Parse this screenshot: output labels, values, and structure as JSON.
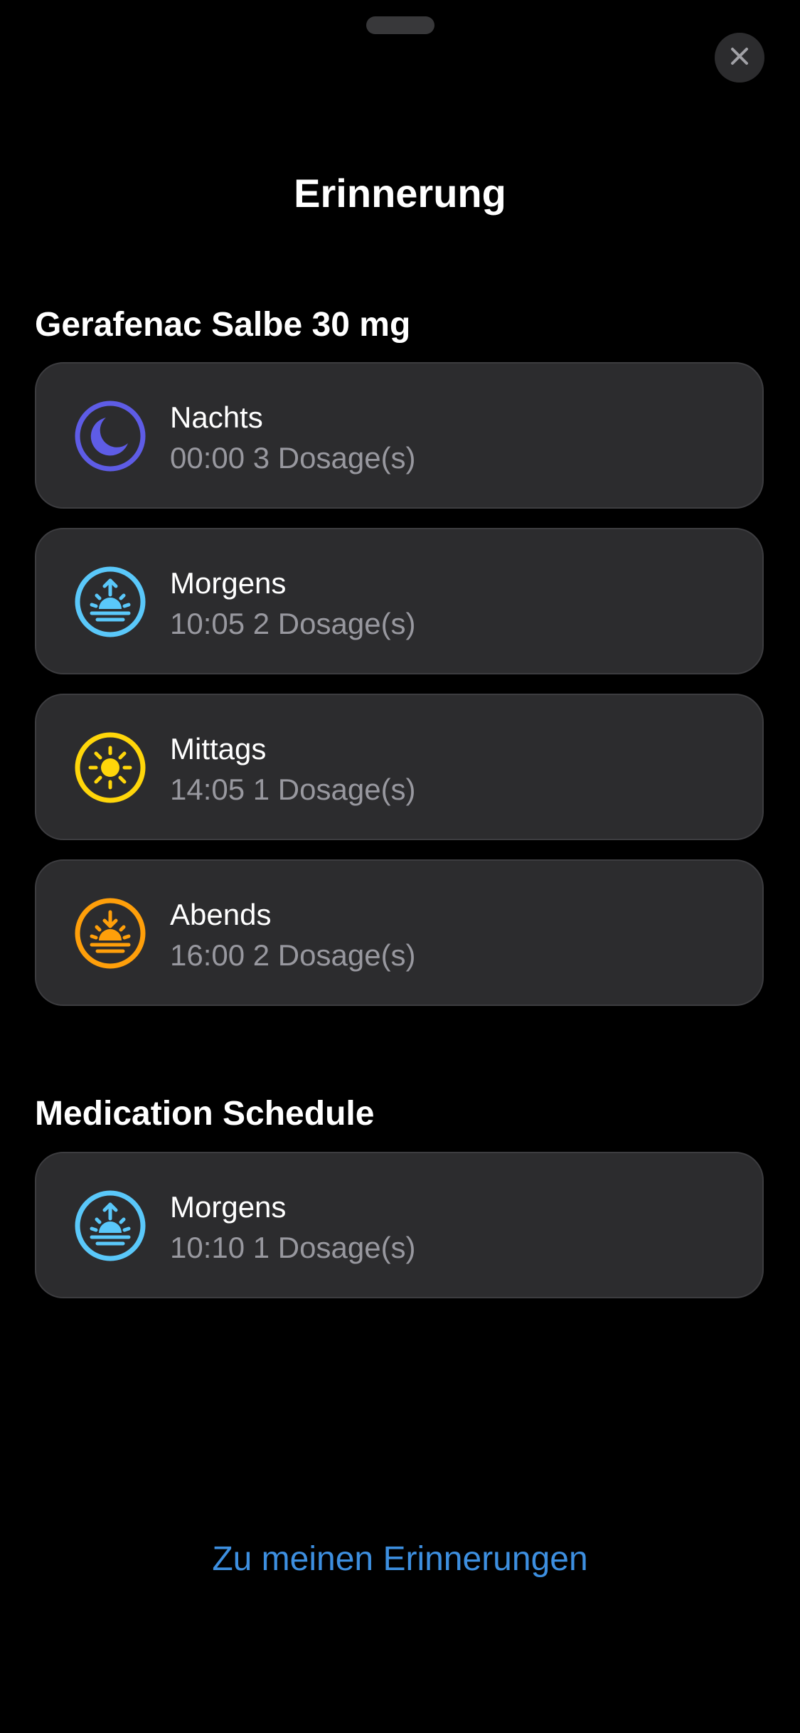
{
  "header": {
    "title": "Erinnerung",
    "close_icon": "xmark-icon"
  },
  "sections": [
    {
      "title": "Gerafenac Salbe 30 mg",
      "items": [
        {
          "label": "Nachts",
          "detail": "00:00 3 Dosage(s)",
          "icon": "moon-icon",
          "color": "#5e5ce6"
        },
        {
          "label": "Morgens",
          "detail": "10:05 2 Dosage(s)",
          "icon": "sunrise-icon",
          "color": "#5ac8fa"
        },
        {
          "label": "Mittags",
          "detail": "14:05 1 Dosage(s)",
          "icon": "sun-icon",
          "color": "#ffd60a"
        },
        {
          "label": "Abends",
          "detail": "16:00 2 Dosage(s)",
          "icon": "sunset-icon",
          "color": "#ff9f0a"
        }
      ]
    },
    {
      "title": "Medication Schedule",
      "items": [
        {
          "label": "Morgens",
          "detail": "10:10 1 Dosage(s)",
          "icon": "sunrise-icon",
          "color": "#5ac8fa"
        }
      ]
    }
  ],
  "footer": {
    "link_label": "Zu meinen Erinnerungen",
    "link_color": "#3d8fe0"
  }
}
